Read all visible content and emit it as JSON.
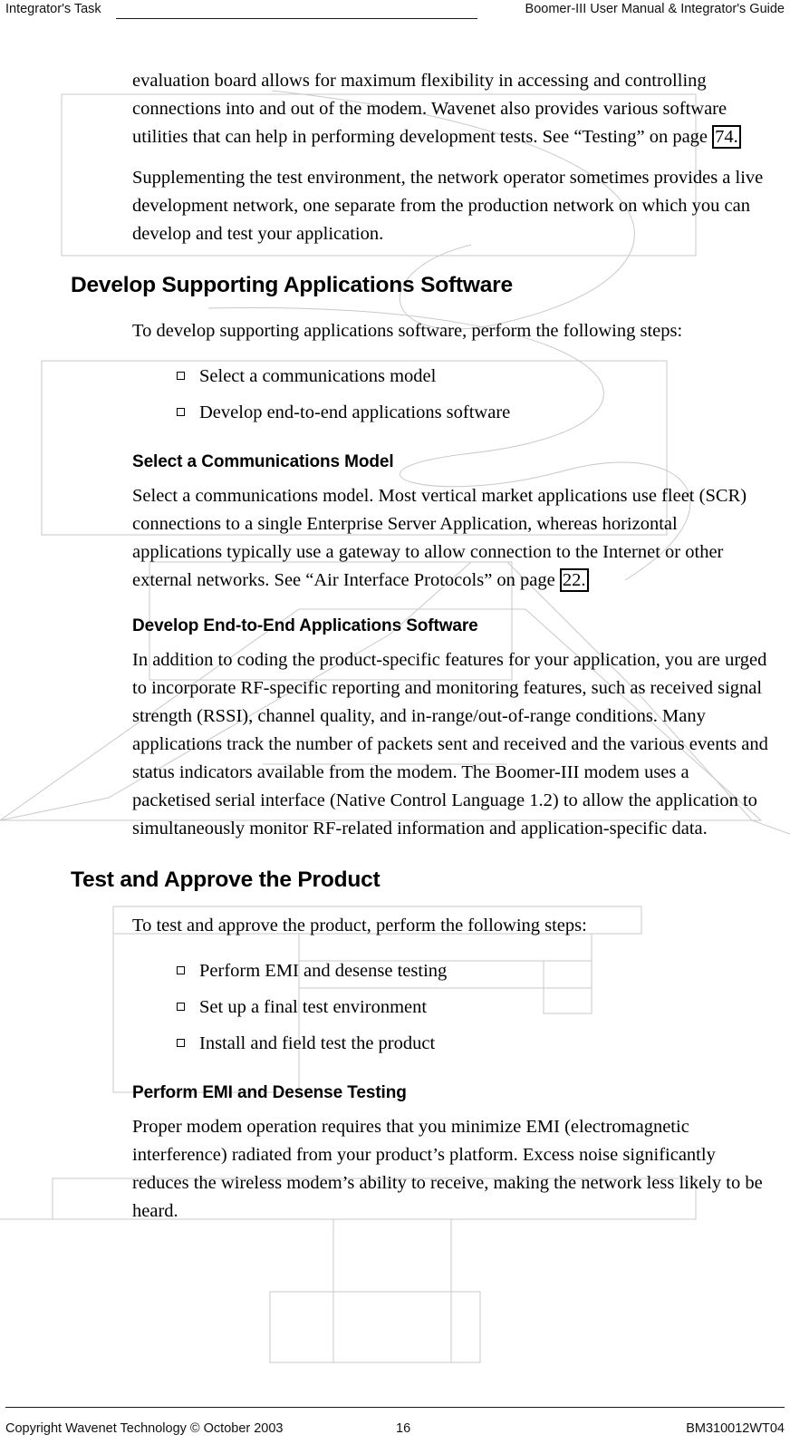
{
  "header": {
    "left_text": "Integrator's Task",
    "right_text": "Boomer-III User Manual & Integrator's Guide"
  },
  "footer": {
    "copyright": "Copyright Wavenet Technology © October 2003",
    "page_number": "16",
    "document_code": "BM310012WT04"
  },
  "content": {
    "para_evaluation_board": "evaluation board allows for maximum flexibility in accessing and controlling connections into and out of the modem. Wavenet also provides various software utilities that can help in performing development tests. See “Testing” on page ",
    "xref_testing": "74.",
    "para_supplementing": "Supplementing the test environment, the network operator sometimes provides a live development network, one separate from the production network on which you can develop and test your application.",
    "heading_develop_supporting": "Develop Supporting Applications Software",
    "para_to_develop_steps": "To develop supporting applications software, perform the following steps:",
    "bullets_develop": [
      "Select a communications model",
      "Develop end-to-end applications software"
    ],
    "subheading_select_model": "Select a Communications Model",
    "para_select_model": "Select a communications model. Most vertical market applications use fleet (SCR) connections to a single Enterprise Server Application, whereas horizontal applications typically use a gateway to allow connection to the Internet or other external networks. See “Air Interface Protocols” on page ",
    "xref_air_interface": "22.",
    "subheading_develop_end_to_end": "Develop End-to-End Applications Software",
    "para_develop_end_to_end": "In addition to coding the product-specific features for your application, you are urged to incorporate RF-specific reporting and monitoring features, such as received signal strength (RSSI), channel quality, and in-range/out-of-range conditions. Many applications track the number of packets sent and received and the various events and status indicators available from the modem. The Boomer-III modem uses a packetised serial interface (Native Control Language 1.2) to allow the application to simultaneously monitor RF-related information and application-specific data.",
    "heading_test_approve": "Test and Approve the Product",
    "para_to_test_steps": "To test and approve the product, perform the following steps:",
    "bullets_test": [
      "Perform EMI and desense testing",
      "Set up a final test environment",
      "Install and field test the product"
    ],
    "subheading_perform_emi": "Perform EMI and Desense Testing",
    "para_perform_emi": "Proper modem operation requires that you minimize EMI (electromagnetic interference) radiated from your product’s platform. Excess noise significantly reduces the wireless modem’s ability to receive, making the network less likely to be heard."
  },
  "colors": {
    "text": "#000000",
    "rule": "#1a1a1a",
    "artifact": "#c9c9c9",
    "page_background": "#ffffff"
  }
}
